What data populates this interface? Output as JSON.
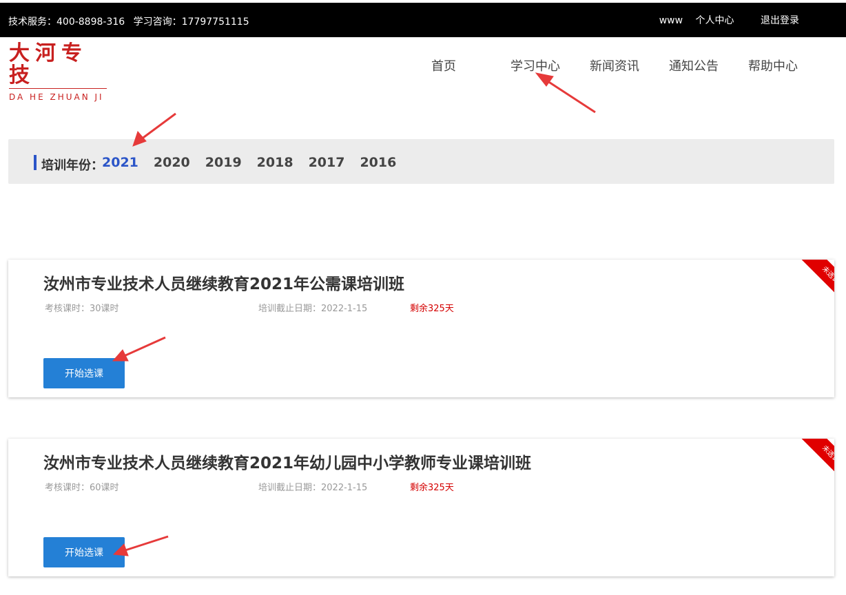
{
  "topbar": {
    "tech_service": "技术服务：400-8898-316",
    "consult": "学习咨询：17797751115",
    "user": "www",
    "personal_center": "个人中心",
    "logout": "退出登录"
  },
  "logo": {
    "cn": "大河专技",
    "en": "DA HE ZHUAN JI"
  },
  "nav": [
    "首页",
    "学习中心",
    "新闻资讯",
    "通知公告",
    "帮助中心"
  ],
  "year_filter": {
    "label": "培训年份：",
    "years": [
      "2021",
      "2020",
      "2019",
      "2018",
      "2017",
      "2016"
    ],
    "active": "2021"
  },
  "courses": [
    {
      "title": "汝州市专业技术人员继续教育2021年公需课培训班",
      "hours": "考核课时：30课时",
      "deadline": "培训截止日期：2022-1-15",
      "remaining": "剩余325天",
      "button": "开始选课",
      "ribbon": "未选课"
    },
    {
      "title": "汝州市专业技术人员继续教育2021年幼儿园中小学教师专业课培训班",
      "hours": "考核课时：60课时",
      "deadline": "培训截止日期：2022-1-15",
      "remaining": "剩余325天",
      "button": "开始选课",
      "ribbon": "未选课"
    }
  ],
  "colors": {
    "accent_blue": "#2b55c8",
    "button_blue": "#2480d6",
    "ribbon_red": "#e00000",
    "logo_red": "#c8201f",
    "annotation_arrow": "#e63a3a"
  }
}
